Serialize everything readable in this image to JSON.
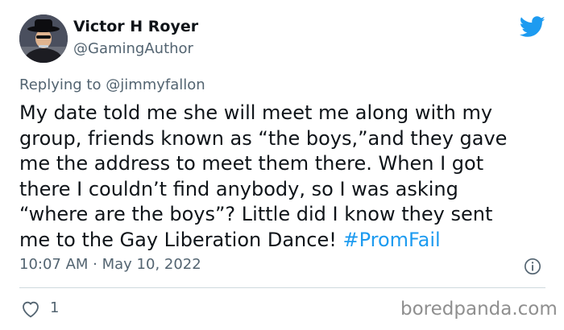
{
  "author": {
    "name": "Victor H Royer",
    "handle": "@GamingAuthor"
  },
  "replying": {
    "prefix": "Replying to ",
    "mention": "@jimmyfallon"
  },
  "tweet": {
    "lines": [
      "My date told me she will meet me along with my",
      "group, friends known as “the boys,”and they gave",
      "me the address to meet them there. When I got",
      "there I couldn’t find anybody, so I was asking",
      "“where are the boys”? Little did I know they sent",
      "me to the Gay Liberation Dance! "
    ],
    "hashtag": "#PromFail"
  },
  "timestamp": "10:07 AM · May 10, 2022",
  "likes": "1",
  "watermark": "boredpanda.com",
  "icons": {
    "platform": "twitter-bird-icon",
    "info": "info-icon",
    "like": "heart-icon"
  },
  "colors": {
    "accent": "#1d9bf0",
    "text": "#0f1419",
    "secondary": "#536471",
    "divider": "#cfd9de"
  }
}
